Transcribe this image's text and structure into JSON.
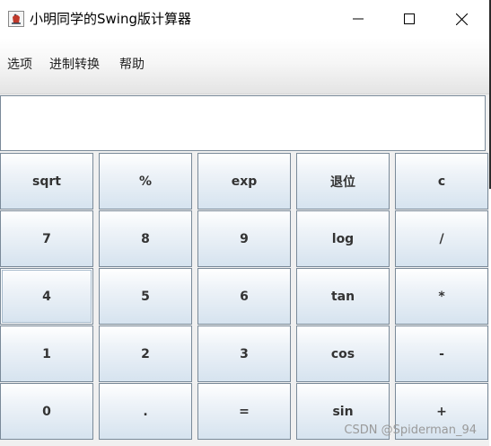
{
  "window": {
    "title": "小明同学的Swing版计算器",
    "icon": "java-cup-icon",
    "controls": {
      "minimize": "minimize-icon",
      "maximize": "maximize-icon",
      "close": "close-icon"
    }
  },
  "menubar": {
    "items": [
      {
        "label": "选项"
      },
      {
        "label": "进制转换"
      },
      {
        "label": "帮助"
      }
    ]
  },
  "display": {
    "value": ""
  },
  "keypad": {
    "rows": [
      [
        "sqrt",
        "%",
        "exp",
        "退位",
        "c"
      ],
      [
        "7",
        "8",
        "9",
        "log",
        "/"
      ],
      [
        "4",
        "5",
        "6",
        "tan",
        "*"
      ],
      [
        "1",
        "2",
        "3",
        "cos",
        "-"
      ],
      [
        "0",
        ".",
        "=",
        "sin",
        "+"
      ]
    ],
    "focused_key": "4"
  },
  "watermark": "CSDN @Spiderman_94",
  "colors": {
    "button_border": "#7a8a99",
    "button_gradient_top": "#ffffff",
    "button_gradient_bottom": "#d6e3ef",
    "button_text": "#333333"
  }
}
